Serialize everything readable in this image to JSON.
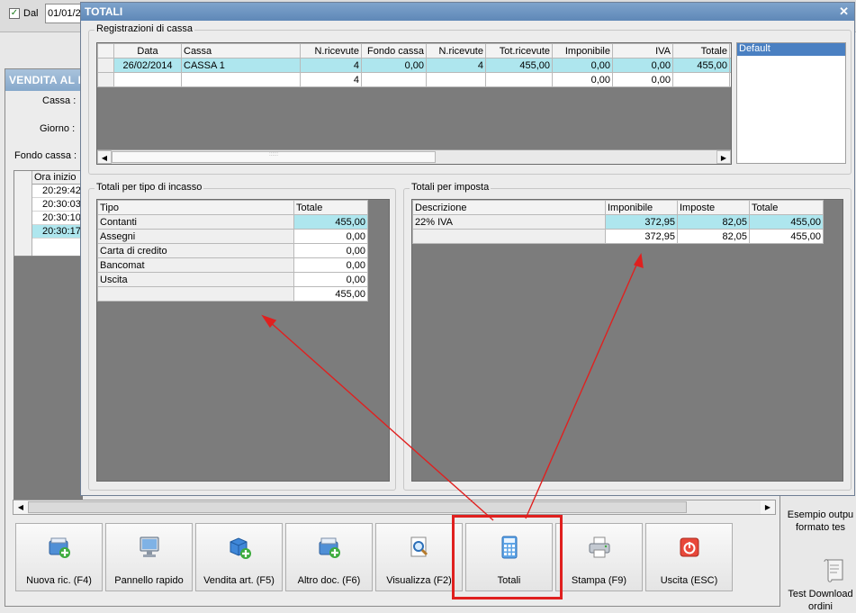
{
  "background": {
    "date_filter": {
      "label": "Dal",
      "checked": true,
      "value": "01/01/2"
    },
    "window_title": "VENDITA AL B",
    "fields": [
      {
        "label": "Cassa :"
      },
      {
        "label": "Giorno :"
      },
      {
        "label": "Fondo cassa :"
      }
    ],
    "times_header": "Ora inizio",
    "times": [
      {
        "value": "20:29:42",
        "selected": false
      },
      {
        "value": "20:30:03",
        "selected": false
      },
      {
        "value": "20:30:10",
        "selected": false
      },
      {
        "value": "20:30:17",
        "selected": true
      }
    ],
    "toolbar": [
      {
        "label": "Nuova ric. (F4)",
        "icon": "new-receipt-icon"
      },
      {
        "label": "Pannello rapido",
        "icon": "monitor-icon"
      },
      {
        "label": "Vendita art. (F5)",
        "icon": "cube-add-icon"
      },
      {
        "label": "Altro doc. (F6)",
        "icon": "documents-add-icon"
      },
      {
        "label": "Visualizza (F2)",
        "icon": "magnifier-icon"
      },
      {
        "label": "Totali",
        "icon": "calculator-icon"
      },
      {
        "label": "Stampa (F9)",
        "icon": "printer-icon"
      },
      {
        "label": "Uscita (ESC)",
        "icon": "power-icon"
      }
    ],
    "side_items": [
      {
        "line1": "Esempio outpu",
        "line2": "formato tes"
      },
      {
        "line1": "Test Download",
        "line2": "ordini"
      }
    ]
  },
  "dialog": {
    "title": "TOTALI",
    "close": "✕",
    "registrazioni": {
      "title": "Registrazioni di cassa",
      "columns": [
        "Data",
        "Cassa",
        "N.ricevute",
        "Fondo cassa",
        "N.ricevute",
        "Tot.ricevute",
        "Imponibile",
        "IVA",
        "Totale"
      ],
      "rows": [
        [
          "26/02/2014",
          "CASSA 1",
          "4",
          "0,00",
          "4",
          "455,00",
          "0,00",
          "0,00",
          "455,00"
        ],
        [
          "",
          "",
          "4",
          "",
          "",
          "",
          "0,00",
          "0,00",
          ""
        ]
      ],
      "list_item": "Default"
    },
    "per_tipo": {
      "title": "Totali per tipo di incasso",
      "columns": [
        "Tipo",
        "Totale"
      ],
      "rows": [
        [
          "Contanti",
          "455,00"
        ],
        [
          "Assegni",
          "0,00"
        ],
        [
          "Carta di credito",
          "0,00"
        ],
        [
          "Bancomat",
          "0,00"
        ],
        [
          "Uscita",
          "0,00"
        ],
        [
          "",
          "455,00"
        ]
      ]
    },
    "per_imposta": {
      "title": "Totali per imposta",
      "columns": [
        "Descrizione",
        "Imponibile",
        "Imposte",
        "Totale"
      ],
      "rows": [
        [
          "22% IVA",
          "372,95",
          "82,05",
          "455,00"
        ],
        [
          "",
          "372,95",
          "82,05",
          "455,00"
        ]
      ]
    }
  },
  "colors": {
    "highlight": "#e0201f",
    "selection": "#aee6ee",
    "grid_bg": "#7c7c7c",
    "title_bar": "#5f88b7"
  }
}
